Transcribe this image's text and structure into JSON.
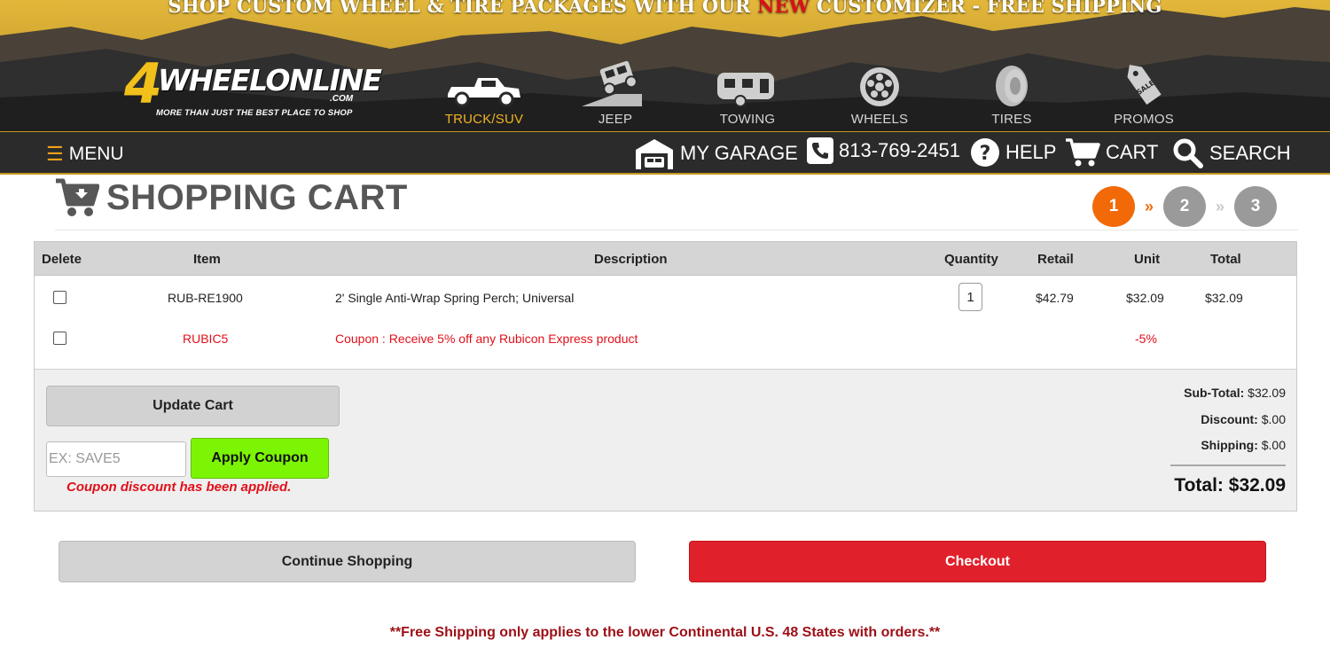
{
  "banner": {
    "pre": "SHOP CUSTOM WHEEL & TIRE PACKAGES WITH OUR ",
    "new": "NEW",
    "post": " CUSTOMIZER - FREE SHIPPING"
  },
  "logo": {
    "number": "4",
    "name": "WHEELONLINE",
    "suffix": ".COM",
    "tagline": "MORE THAN JUST THE BEST PLACE TO SHOP"
  },
  "categories": [
    {
      "label": "TRUCK/SUV",
      "icon": "truck-icon",
      "active": true
    },
    {
      "label": "JEEP",
      "icon": "jeep-icon"
    },
    {
      "label": "TOWING",
      "icon": "trailer-icon"
    },
    {
      "label": "WHEELS",
      "icon": "wheel-icon"
    },
    {
      "label": "TIRES",
      "icon": "tire-icon"
    },
    {
      "label": "PROMOS",
      "icon": "sale-tag-icon"
    }
  ],
  "nav": {
    "menu": "MENU",
    "garage": "MY GARAGE",
    "phone": "813-769-2451",
    "help": "HELP",
    "cart": "CART",
    "search": "SEARCH"
  },
  "page": {
    "title": "SHOPPING CART",
    "steps": [
      "1",
      "2",
      "3"
    ],
    "current_step": 1,
    "chevron": "»"
  },
  "table": {
    "headers": {
      "delete": "Delete",
      "item": "Item",
      "description": "Description",
      "quantity": "Quantity",
      "retail": "Retail",
      "unit": "Unit",
      "total": "Total"
    },
    "rows": [
      {
        "item": "RUB-RE1900",
        "description": "2' Single Anti-Wrap Spring Perch; Universal",
        "quantity": "1",
        "retail": "$42.79",
        "unit": "$32.09",
        "total": "$32.09"
      },
      {
        "item": "RUBIC5",
        "description": "Coupon : Receive 5% off any Rubicon Express product",
        "unit": "-5%"
      }
    ]
  },
  "cart_actions": {
    "update": "Update Cart",
    "coupon_placeholder": "EX: SAVE5",
    "apply": "Apply Coupon",
    "applied_message": "Coupon discount has been applied."
  },
  "totals": {
    "subtotal_label": "Sub-Total:",
    "subtotal": "$32.09",
    "discount_label": "Discount:",
    "discount": "$.00",
    "shipping_label": "Shipping:",
    "shipping": "$.00",
    "total_label": "Total:",
    "total": "$32.09"
  },
  "footer_actions": {
    "continue": "Continue Shopping",
    "checkout": "Checkout"
  },
  "shipping_note": "**Free Shipping only applies to the lower Continental U.S. 48 States with orders.**",
  "colors": {
    "accent_orange": "#f26a08",
    "checkout_red": "#e0202a",
    "apply_green": "#7cf505",
    "gold": "#f0b323"
  }
}
